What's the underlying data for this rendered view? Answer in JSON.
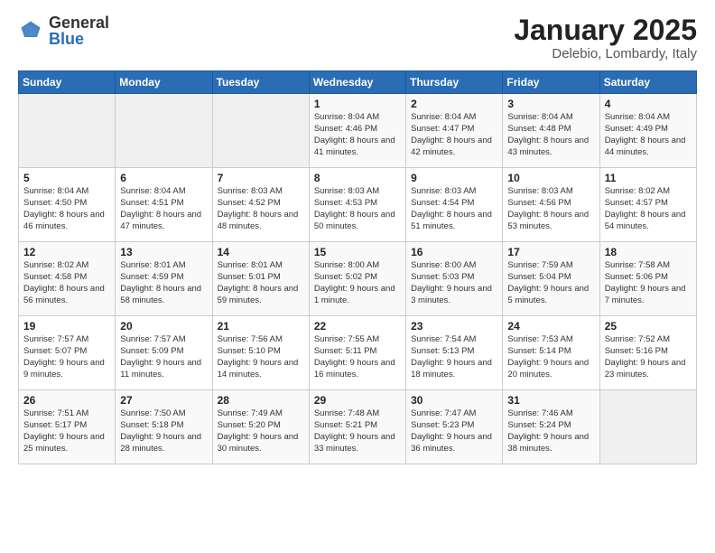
{
  "header": {
    "logo_general": "General",
    "logo_blue": "Blue",
    "month": "January 2025",
    "location": "Delebio, Lombardy, Italy"
  },
  "weekdays": [
    "Sunday",
    "Monday",
    "Tuesday",
    "Wednesday",
    "Thursday",
    "Friday",
    "Saturday"
  ],
  "weeks": [
    [
      {
        "day": "",
        "info": ""
      },
      {
        "day": "",
        "info": ""
      },
      {
        "day": "",
        "info": ""
      },
      {
        "day": "1",
        "info": "Sunrise: 8:04 AM\nSunset: 4:46 PM\nDaylight: 8 hours and 41 minutes."
      },
      {
        "day": "2",
        "info": "Sunrise: 8:04 AM\nSunset: 4:47 PM\nDaylight: 8 hours and 42 minutes."
      },
      {
        "day": "3",
        "info": "Sunrise: 8:04 AM\nSunset: 4:48 PM\nDaylight: 8 hours and 43 minutes."
      },
      {
        "day": "4",
        "info": "Sunrise: 8:04 AM\nSunset: 4:49 PM\nDaylight: 8 hours and 44 minutes."
      }
    ],
    [
      {
        "day": "5",
        "info": "Sunrise: 8:04 AM\nSunset: 4:50 PM\nDaylight: 8 hours and 46 minutes."
      },
      {
        "day": "6",
        "info": "Sunrise: 8:04 AM\nSunset: 4:51 PM\nDaylight: 8 hours and 47 minutes."
      },
      {
        "day": "7",
        "info": "Sunrise: 8:03 AM\nSunset: 4:52 PM\nDaylight: 8 hours and 48 minutes."
      },
      {
        "day": "8",
        "info": "Sunrise: 8:03 AM\nSunset: 4:53 PM\nDaylight: 8 hours and 50 minutes."
      },
      {
        "day": "9",
        "info": "Sunrise: 8:03 AM\nSunset: 4:54 PM\nDaylight: 8 hours and 51 minutes."
      },
      {
        "day": "10",
        "info": "Sunrise: 8:03 AM\nSunset: 4:56 PM\nDaylight: 8 hours and 53 minutes."
      },
      {
        "day": "11",
        "info": "Sunrise: 8:02 AM\nSunset: 4:57 PM\nDaylight: 8 hours and 54 minutes."
      }
    ],
    [
      {
        "day": "12",
        "info": "Sunrise: 8:02 AM\nSunset: 4:58 PM\nDaylight: 8 hours and 56 minutes."
      },
      {
        "day": "13",
        "info": "Sunrise: 8:01 AM\nSunset: 4:59 PM\nDaylight: 8 hours and 58 minutes."
      },
      {
        "day": "14",
        "info": "Sunrise: 8:01 AM\nSunset: 5:01 PM\nDaylight: 8 hours and 59 minutes."
      },
      {
        "day": "15",
        "info": "Sunrise: 8:00 AM\nSunset: 5:02 PM\nDaylight: 9 hours and 1 minute."
      },
      {
        "day": "16",
        "info": "Sunrise: 8:00 AM\nSunset: 5:03 PM\nDaylight: 9 hours and 3 minutes."
      },
      {
        "day": "17",
        "info": "Sunrise: 7:59 AM\nSunset: 5:04 PM\nDaylight: 9 hours and 5 minutes."
      },
      {
        "day": "18",
        "info": "Sunrise: 7:58 AM\nSunset: 5:06 PM\nDaylight: 9 hours and 7 minutes."
      }
    ],
    [
      {
        "day": "19",
        "info": "Sunrise: 7:57 AM\nSunset: 5:07 PM\nDaylight: 9 hours and 9 minutes."
      },
      {
        "day": "20",
        "info": "Sunrise: 7:57 AM\nSunset: 5:09 PM\nDaylight: 9 hours and 11 minutes."
      },
      {
        "day": "21",
        "info": "Sunrise: 7:56 AM\nSunset: 5:10 PM\nDaylight: 9 hours and 14 minutes."
      },
      {
        "day": "22",
        "info": "Sunrise: 7:55 AM\nSunset: 5:11 PM\nDaylight: 9 hours and 16 minutes."
      },
      {
        "day": "23",
        "info": "Sunrise: 7:54 AM\nSunset: 5:13 PM\nDaylight: 9 hours and 18 minutes."
      },
      {
        "day": "24",
        "info": "Sunrise: 7:53 AM\nSunset: 5:14 PM\nDaylight: 9 hours and 20 minutes."
      },
      {
        "day": "25",
        "info": "Sunrise: 7:52 AM\nSunset: 5:16 PM\nDaylight: 9 hours and 23 minutes."
      }
    ],
    [
      {
        "day": "26",
        "info": "Sunrise: 7:51 AM\nSunset: 5:17 PM\nDaylight: 9 hours and 25 minutes."
      },
      {
        "day": "27",
        "info": "Sunrise: 7:50 AM\nSunset: 5:18 PM\nDaylight: 9 hours and 28 minutes."
      },
      {
        "day": "28",
        "info": "Sunrise: 7:49 AM\nSunset: 5:20 PM\nDaylight: 9 hours and 30 minutes."
      },
      {
        "day": "29",
        "info": "Sunrise: 7:48 AM\nSunset: 5:21 PM\nDaylight: 9 hours and 33 minutes."
      },
      {
        "day": "30",
        "info": "Sunrise: 7:47 AM\nSunset: 5:23 PM\nDaylight: 9 hours and 36 minutes."
      },
      {
        "day": "31",
        "info": "Sunrise: 7:46 AM\nSunset: 5:24 PM\nDaylight: 9 hours and 38 minutes."
      },
      {
        "day": "",
        "info": ""
      }
    ]
  ]
}
